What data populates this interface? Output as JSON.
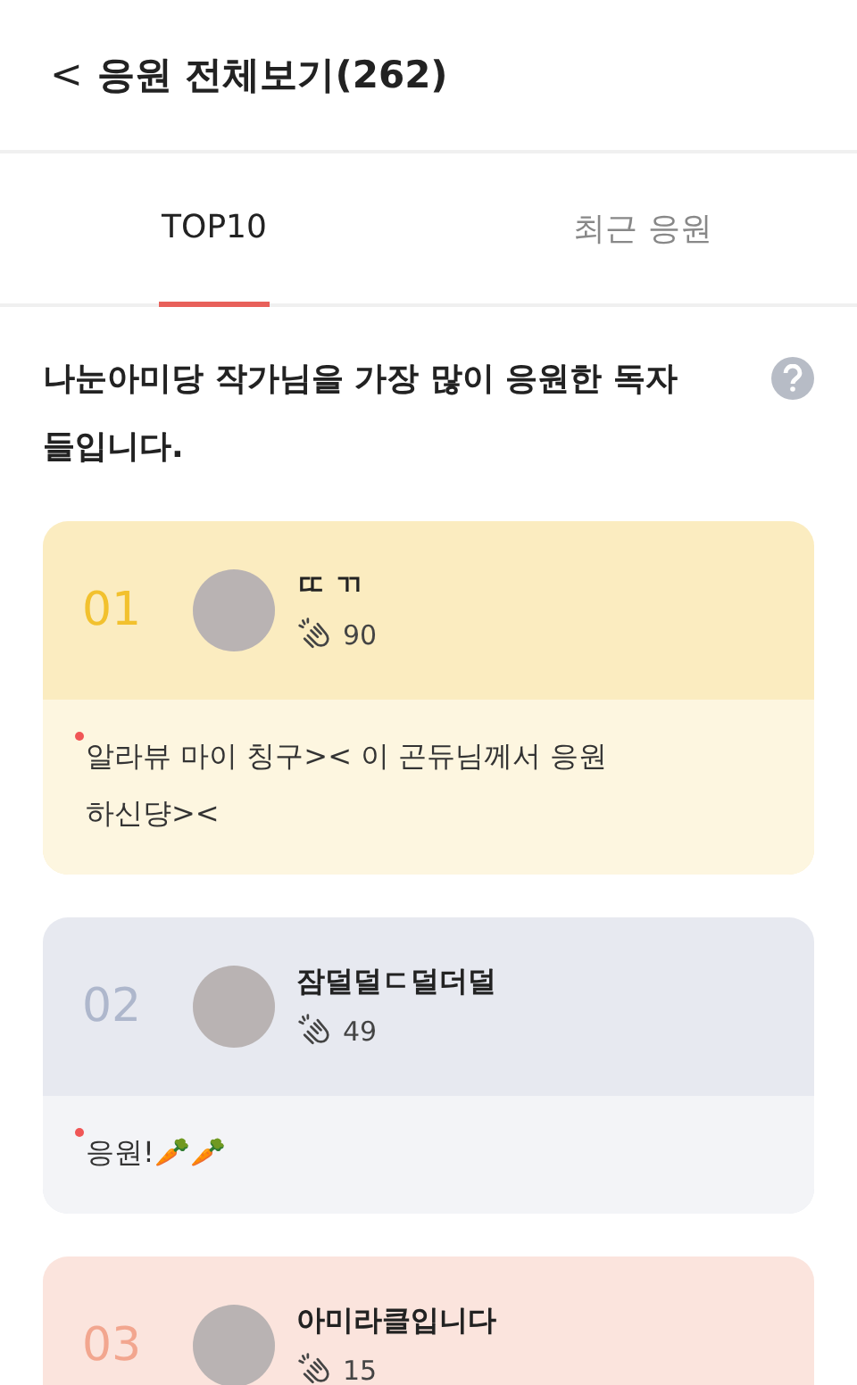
{
  "header": {
    "back": "<",
    "title": "응원 전체보기(262)"
  },
  "tabs": [
    {
      "label": "TOP10",
      "selected": true
    },
    {
      "label": "최근 응원",
      "selected": false
    }
  ],
  "intro": "나눈아미당 작가님을 가장 많이 응원한 독자들입니다.",
  "cards": [
    {
      "rank": "01",
      "color": "#f2c12e",
      "name": "ㄸ ㄲ",
      "claps": "90",
      "comment": "알라뷰 마이 칭구>< 이 곤듀님께서 응원하신댱><",
      "unread": true
    },
    {
      "rank": "02",
      "color": "#aeb7cc",
      "name": "잠덜덜ㄷ덜더덜",
      "claps": "49",
      "comment": "응원!🥕🥕",
      "unread": true
    },
    {
      "rank": "03",
      "color": "#f2a68f",
      "name": "아미라클입니다",
      "claps": "15"
    }
  ]
}
